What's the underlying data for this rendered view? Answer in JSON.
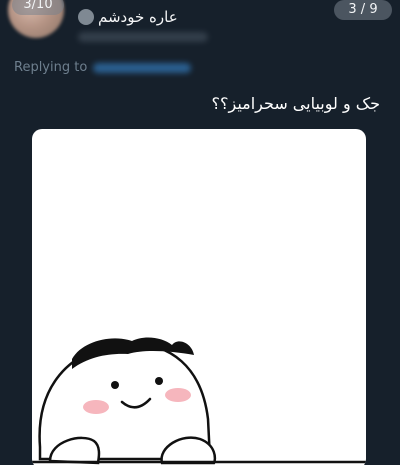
{
  "header": {
    "page_counter_left": "3/10",
    "page_counter_right": "3 / 9",
    "author_name": "عاره خودشم"
  },
  "reply": {
    "label": "Replying to"
  },
  "tweet": {
    "text": "جک و لوبیایی سحرامیز؟؟"
  },
  "media": {
    "icon": "blob-character-sticker"
  }
}
